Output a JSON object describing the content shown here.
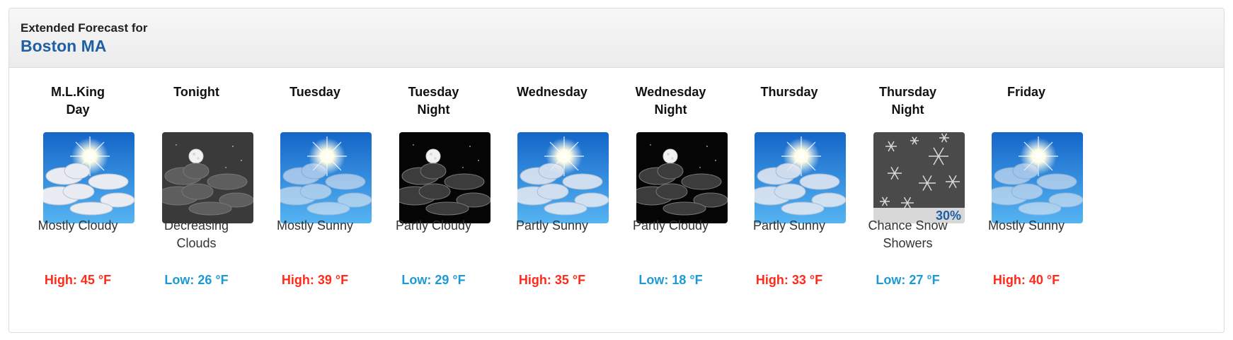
{
  "header": {
    "subtitle": "Extended Forecast for",
    "location": "Boston MA"
  },
  "forecast": [
    {
      "period": "M.L.King\nDay",
      "icon": "mostly-cloudy-day-icon",
      "short_desc": "Mostly Cloudy",
      "temp": "High: 45 °F",
      "temp_type": "high"
    },
    {
      "period": "Tonight",
      "icon": "decreasing-clouds-night-icon",
      "short_desc": "Decreasing\nClouds",
      "temp": "Low: 26 °F",
      "temp_type": "low"
    },
    {
      "period": "Tuesday",
      "icon": "mostly-sunny-icon",
      "short_desc": "Mostly Sunny",
      "temp": "High: 39 °F",
      "temp_type": "high"
    },
    {
      "period": "Tuesday\nNight",
      "icon": "partly-cloudy-night-icon",
      "short_desc": "Partly Cloudy",
      "temp": "Low: 29 °F",
      "temp_type": "low"
    },
    {
      "period": "Wednesday",
      "icon": "partly-sunny-icon",
      "short_desc": "Partly Sunny",
      "temp": "High: 35 °F",
      "temp_type": "high"
    },
    {
      "period": "Wednesday\nNight",
      "icon": "partly-cloudy-night-icon",
      "short_desc": "Partly Cloudy",
      "temp": "Low: 18 °F",
      "temp_type": "low"
    },
    {
      "period": "Thursday",
      "icon": "partly-sunny-icon",
      "short_desc": "Partly Sunny",
      "temp": "High: 33 °F",
      "temp_type": "high"
    },
    {
      "period": "Thursday\nNight",
      "icon": "snow-showers-icon",
      "short_desc": "Chance Snow\nShowers",
      "temp": "Low: 27 °F",
      "temp_type": "low",
      "precip_chance": "30%"
    },
    {
      "period": "Friday",
      "icon": "mostly-sunny-icon",
      "short_desc": "Mostly Sunny",
      "temp": "High: 40 °F",
      "temp_type": "high"
    }
  ],
  "colors": {
    "title": "#1f5fa4",
    "high": "#ff2a1a",
    "low": "#1d9ad6"
  }
}
